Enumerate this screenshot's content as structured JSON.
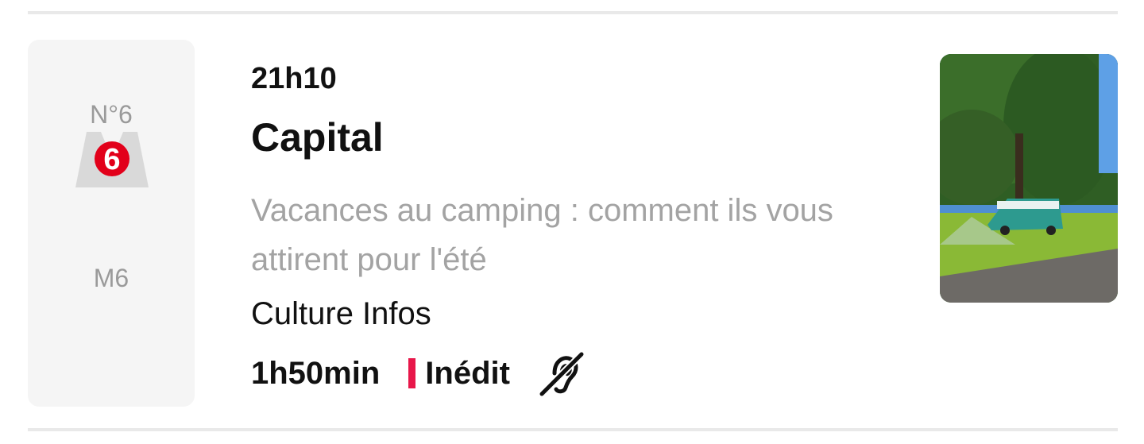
{
  "channel": {
    "number": "N°6",
    "name": "M6",
    "logo_icon": "m6-logo-icon",
    "logo_accent": "#e2001a"
  },
  "program": {
    "time": "21h10",
    "title": "Capital",
    "subtitle": "Vacances au camping : comment ils vous attirent pour l'été",
    "category": "Culture Infos",
    "duration": "1h50min",
    "badge": "Inédit",
    "badge_color": "#e8174a",
    "accessibility_icon": "hearing-impaired-icon",
    "thumbnail": "camping-photo"
  }
}
